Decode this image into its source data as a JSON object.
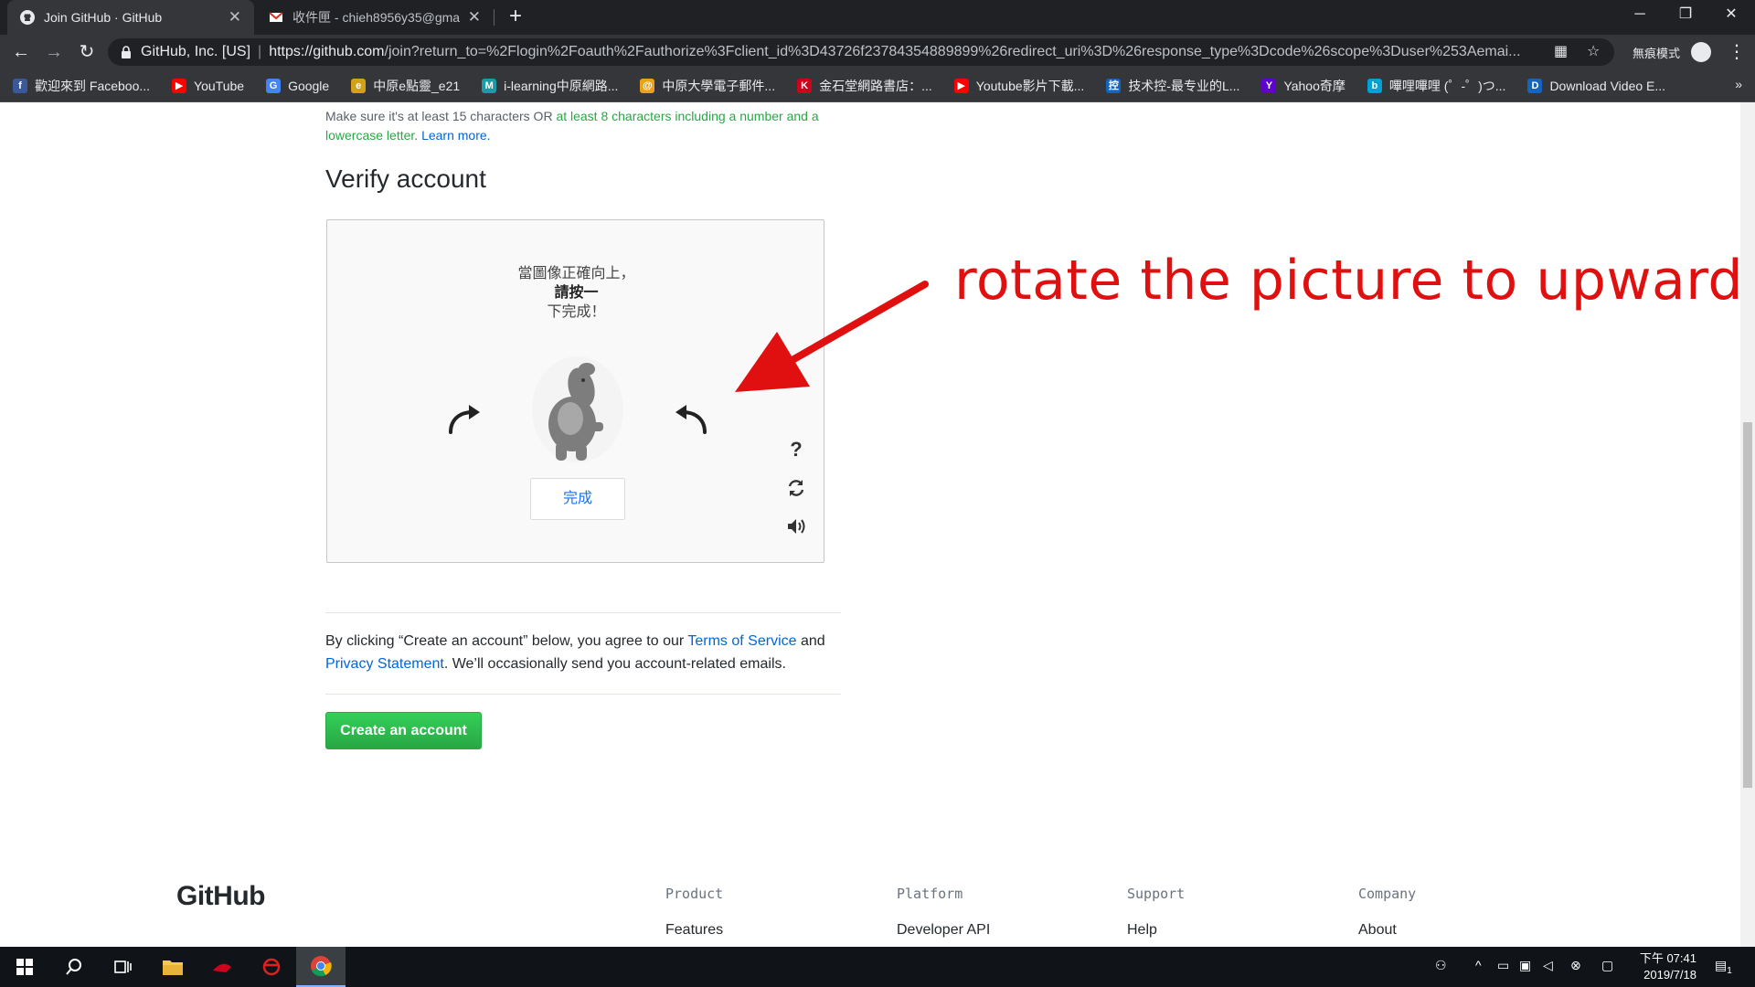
{
  "browser": {
    "tabs": [
      {
        "title": "Join GitHub · GitHub",
        "active": true
      },
      {
        "title": "收件匣 - chieh8956y35@gmail.",
        "active": false
      }
    ],
    "new_tab": "+",
    "window_controls": {
      "minimize": "─",
      "restore": "❐",
      "close": "✕"
    },
    "address": {
      "org": "GitHub, Inc. [US]",
      "pipe": "|",
      "url_host": "https://github.com",
      "url_path": "/join?return_to=%2Flogin%2Foauth%2Fauthorize%3Fclient_id%3D43726f23784354889899%26redirect_uri%3D%26response_type%3Dcode%26scope%3Duser%253Aemai..."
    },
    "incognito_label": "無痕模式",
    "bookmarks": [
      {
        "label": "歡迎來到 Faceboo...",
        "icon": "facebook-icon",
        "color": "#3b5998",
        "glyph": "f"
      },
      {
        "label": "YouTube",
        "icon": "youtube-icon",
        "color": "#ff0000",
        "glyph": "▶"
      },
      {
        "label": "Google",
        "icon": "google-icon",
        "color": "#4285f4",
        "glyph": "G"
      },
      {
        "label": "中原e點靈_e21",
        "icon": "cycu-icon",
        "color": "#d4a017",
        "glyph": "e"
      },
      {
        "label": "i-learning中原網路...",
        "icon": "ilearning-icon",
        "color": "#1a9ba5",
        "glyph": "M"
      },
      {
        "label": "中原大學電子郵件...",
        "icon": "mail-icon",
        "color": "#e8a317",
        "glyph": "@"
      },
      {
        "label": "金石堂網路書店：...",
        "icon": "kingstone-icon",
        "color": "#d0021b",
        "glyph": "K"
      },
      {
        "label": "Youtube影片下載...",
        "icon": "youtube-dl-icon",
        "color": "#ff0000",
        "glyph": "▶"
      },
      {
        "label": "技术控-最专业的L...",
        "icon": "jishukong-icon",
        "color": "#1565c0",
        "glyph": "控"
      },
      {
        "label": "Yahoo奇摩",
        "icon": "yahoo-icon",
        "color": "#5f01d1",
        "glyph": "Y"
      },
      {
        "label": "嗶哩嗶哩 (゜-゜)つ...",
        "icon": "bilibili-icon",
        "color": "#00a1d6",
        "glyph": "b"
      },
      {
        "label": "Download Video E...",
        "icon": "download-video-icon",
        "color": "#1565c0",
        "glyph": "D"
      }
    ],
    "bookmarks_more": "»"
  },
  "page": {
    "password_hint": {
      "part1": "Make sure it's at least 15 characters OR ",
      "part2": "at least 8 characters including a number and a lowercase letter",
      "part3": ". ",
      "learn_more": "Learn more."
    },
    "verify_heading": "Verify account",
    "captcha": {
      "instruction_line1": "當圖像正確向上，",
      "instruction_line2": "請按一",
      "instruction_line3": "下完成！",
      "done_label": "完成",
      "help_label": "?"
    },
    "annotation": "rotate the picture to upward",
    "agreement": {
      "before_terms": "By clicking “Create an account” below, you agree to our ",
      "terms": "Terms of Service",
      "and": " and ",
      "privacy": "Privacy Statement",
      "after": ". We’ll occasionally send you account-related emails."
    },
    "create_button": "Create an account",
    "footer": {
      "logo": "GitHub",
      "columns": [
        {
          "heading": "Product",
          "first_link": "Features"
        },
        {
          "heading": "Platform",
          "first_link": "Developer API"
        },
        {
          "heading": "Support",
          "first_link": "Help"
        },
        {
          "heading": "Company",
          "first_link": "About"
        }
      ]
    }
  },
  "taskbar": {
    "time": "下午 07:41",
    "date": "2019/7/18",
    "notification_count": "1"
  },
  "colors": {
    "github_green": "#28a745",
    "link_blue": "#0366d6",
    "annotation_red": "#e01010",
    "chrome_dark": "#202124"
  }
}
